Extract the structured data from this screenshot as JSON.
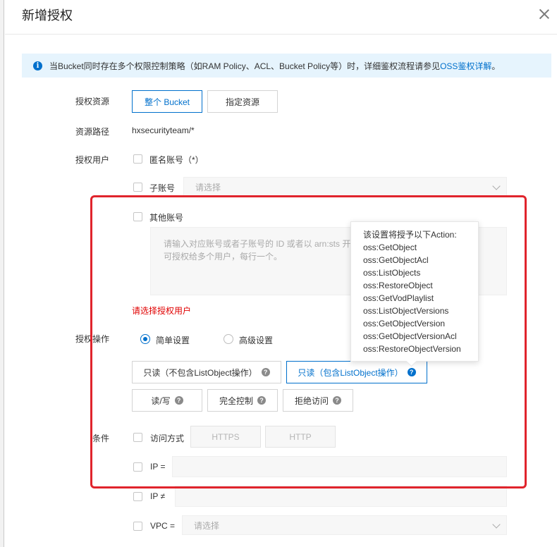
{
  "dialog": {
    "title": "新增授权"
  },
  "info": {
    "text": "当Bucket同时存在多个权限控制策略（如RAM Policy、ACL、Bucket Policy等）时，详细鉴权流程请参见",
    "link": "OSS鉴权详解",
    "suffix": "。"
  },
  "resource": {
    "label": "授权资源",
    "whole_bucket": "整个 Bucket",
    "specific": "指定资源"
  },
  "path": {
    "label": "资源路径",
    "value": "hxsecurityteam/*"
  },
  "users": {
    "label": "授权用户",
    "anonymous": "匿名账号（*）",
    "sub_account": "子账号",
    "sub_placeholder": "请选择",
    "other_account": "其他账号",
    "other_placeholder_1": "请输入对应账号或者子账号的 ID 或者以 arn:sts 开",
    "other_placeholder_2": "可授权给多个用户，每行一个。",
    "error": "请选择授权用户"
  },
  "actions": {
    "label": "授权操作",
    "simple": "简单设置",
    "advanced": "高级设置",
    "readonly_no_list": "只读（不包含ListObject操作）",
    "readonly_with_list": "只读（包含ListObject操作）",
    "read_write": "读/写",
    "full_control": "完全控制",
    "deny": "拒绝访问"
  },
  "tooltip": {
    "heading": "该设置将授予以下Action:",
    "items": [
      "oss:GetObject",
      "oss:GetObjectAcl",
      "oss:ListObjects",
      "oss:RestoreObject",
      "oss:GetVodPlaylist",
      "oss:ListObjectVersions",
      "oss:GetObjectVersion",
      "oss:GetObjectVersionAcl",
      "oss:RestoreObjectVersion"
    ]
  },
  "conditions": {
    "label": "条件",
    "access_method": "访问方式",
    "https": "HTTPS",
    "http": "HTTP",
    "ip_eq": "IP =",
    "ip_neq": "IP ≠",
    "vpc": "VPC =",
    "vpc_placeholder": "请选择"
  },
  "colors": {
    "accent": "#0070cc",
    "error": "#e00000",
    "highlight": "#e0242c"
  }
}
